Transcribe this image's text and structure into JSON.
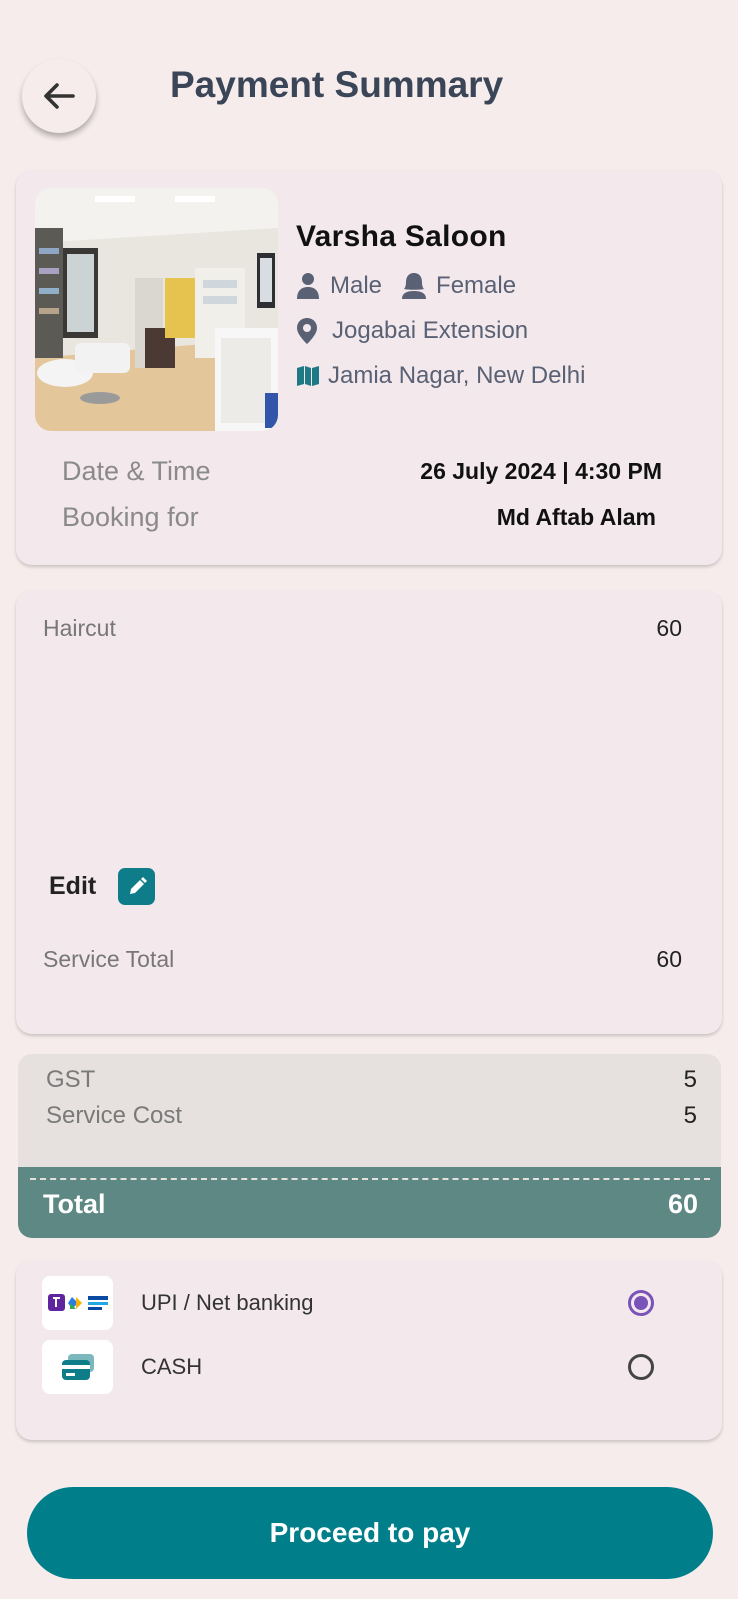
{
  "header": {
    "title": "Payment Summary"
  },
  "salon": {
    "name": "Varsha Saloon",
    "gender_male": "Male",
    "gender_female": "Female",
    "location": "Jogabai Extension",
    "city": "Jamia Nagar, New Delhi"
  },
  "booking": {
    "datetime_label": "Date & Time",
    "datetime_value": "26 July 2024 | 4:30 PM",
    "for_label": "Booking for",
    "for_value": "Md Aftab Alam"
  },
  "services": {
    "items": [
      {
        "name": "Haircut",
        "price": "60"
      }
    ],
    "edit_label": "Edit",
    "total_label": "Service Total",
    "total_value": "60"
  },
  "summary": {
    "gst_label": "GST",
    "gst_value": "5",
    "service_cost_label": "Service Cost",
    "service_cost_value": "5",
    "total_label": "Total",
    "total_value": "60"
  },
  "payment": {
    "options": [
      {
        "label": "UPI / Net banking",
        "selected": true,
        "icon": "upi-logos-icon"
      },
      {
        "label": "CASH",
        "selected": false,
        "icon": "card-icon"
      }
    ]
  },
  "cta": {
    "label": "Proceed to pay"
  },
  "colors": {
    "accent": "#007f8a",
    "total_band": "#5e8884",
    "radio": "#7a53b8"
  }
}
